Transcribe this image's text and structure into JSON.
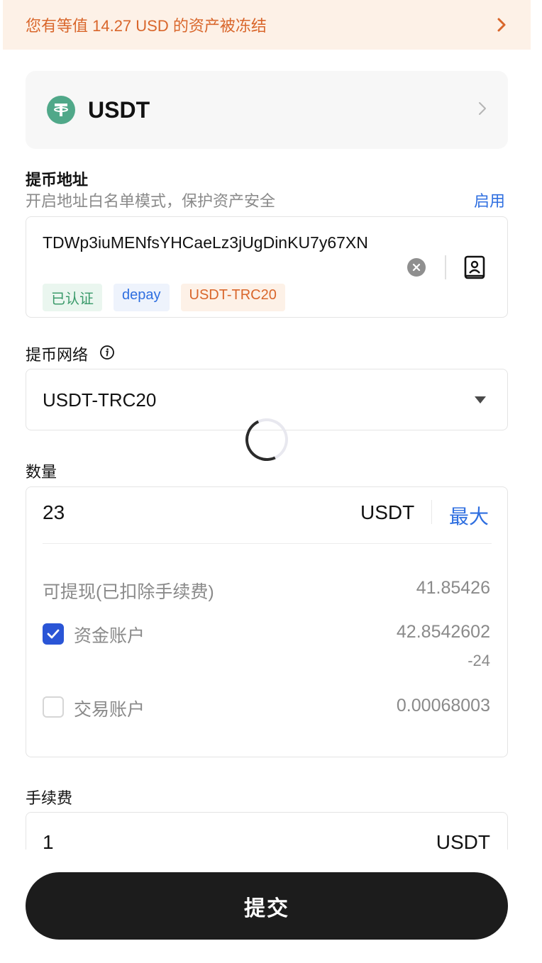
{
  "banner": {
    "text": "您有等值 14.27 USD 的资产被冻结"
  },
  "coin": {
    "name": "USDT"
  },
  "address": {
    "label": "提币地址",
    "hint": "开启地址白名单模式，保护资产安全",
    "enable_link": "启用",
    "value": "TDWp3iuMENfsYHCaeLz3jUgDinKU7y67XN",
    "tags": [
      "已认证",
      "depay",
      "USDT-TRC20"
    ]
  },
  "network": {
    "label": "提币网络",
    "value": "USDT-TRC20"
  },
  "quantity": {
    "label": "数量",
    "value": "23",
    "unit": "USDT",
    "max_label": "最大",
    "available_label": "可提现(已扣除手续费)",
    "available_value": "41.85426",
    "funding_label": "资金账户",
    "funding_value": "42.8542602",
    "funding_value_suffix": "-24",
    "funding_checked": true,
    "trading_label": "交易账户",
    "trading_value": "0.00068003",
    "trading_checked": false
  },
  "fee": {
    "label": "手续费",
    "value": "1",
    "unit": "USDT"
  },
  "submit": {
    "label": "提交"
  },
  "colors": {
    "accent_blue": "#2f6fe0",
    "warning_orange": "#d9662b",
    "tether_green": "#50a889",
    "button_dark": "#1c1c1c"
  }
}
